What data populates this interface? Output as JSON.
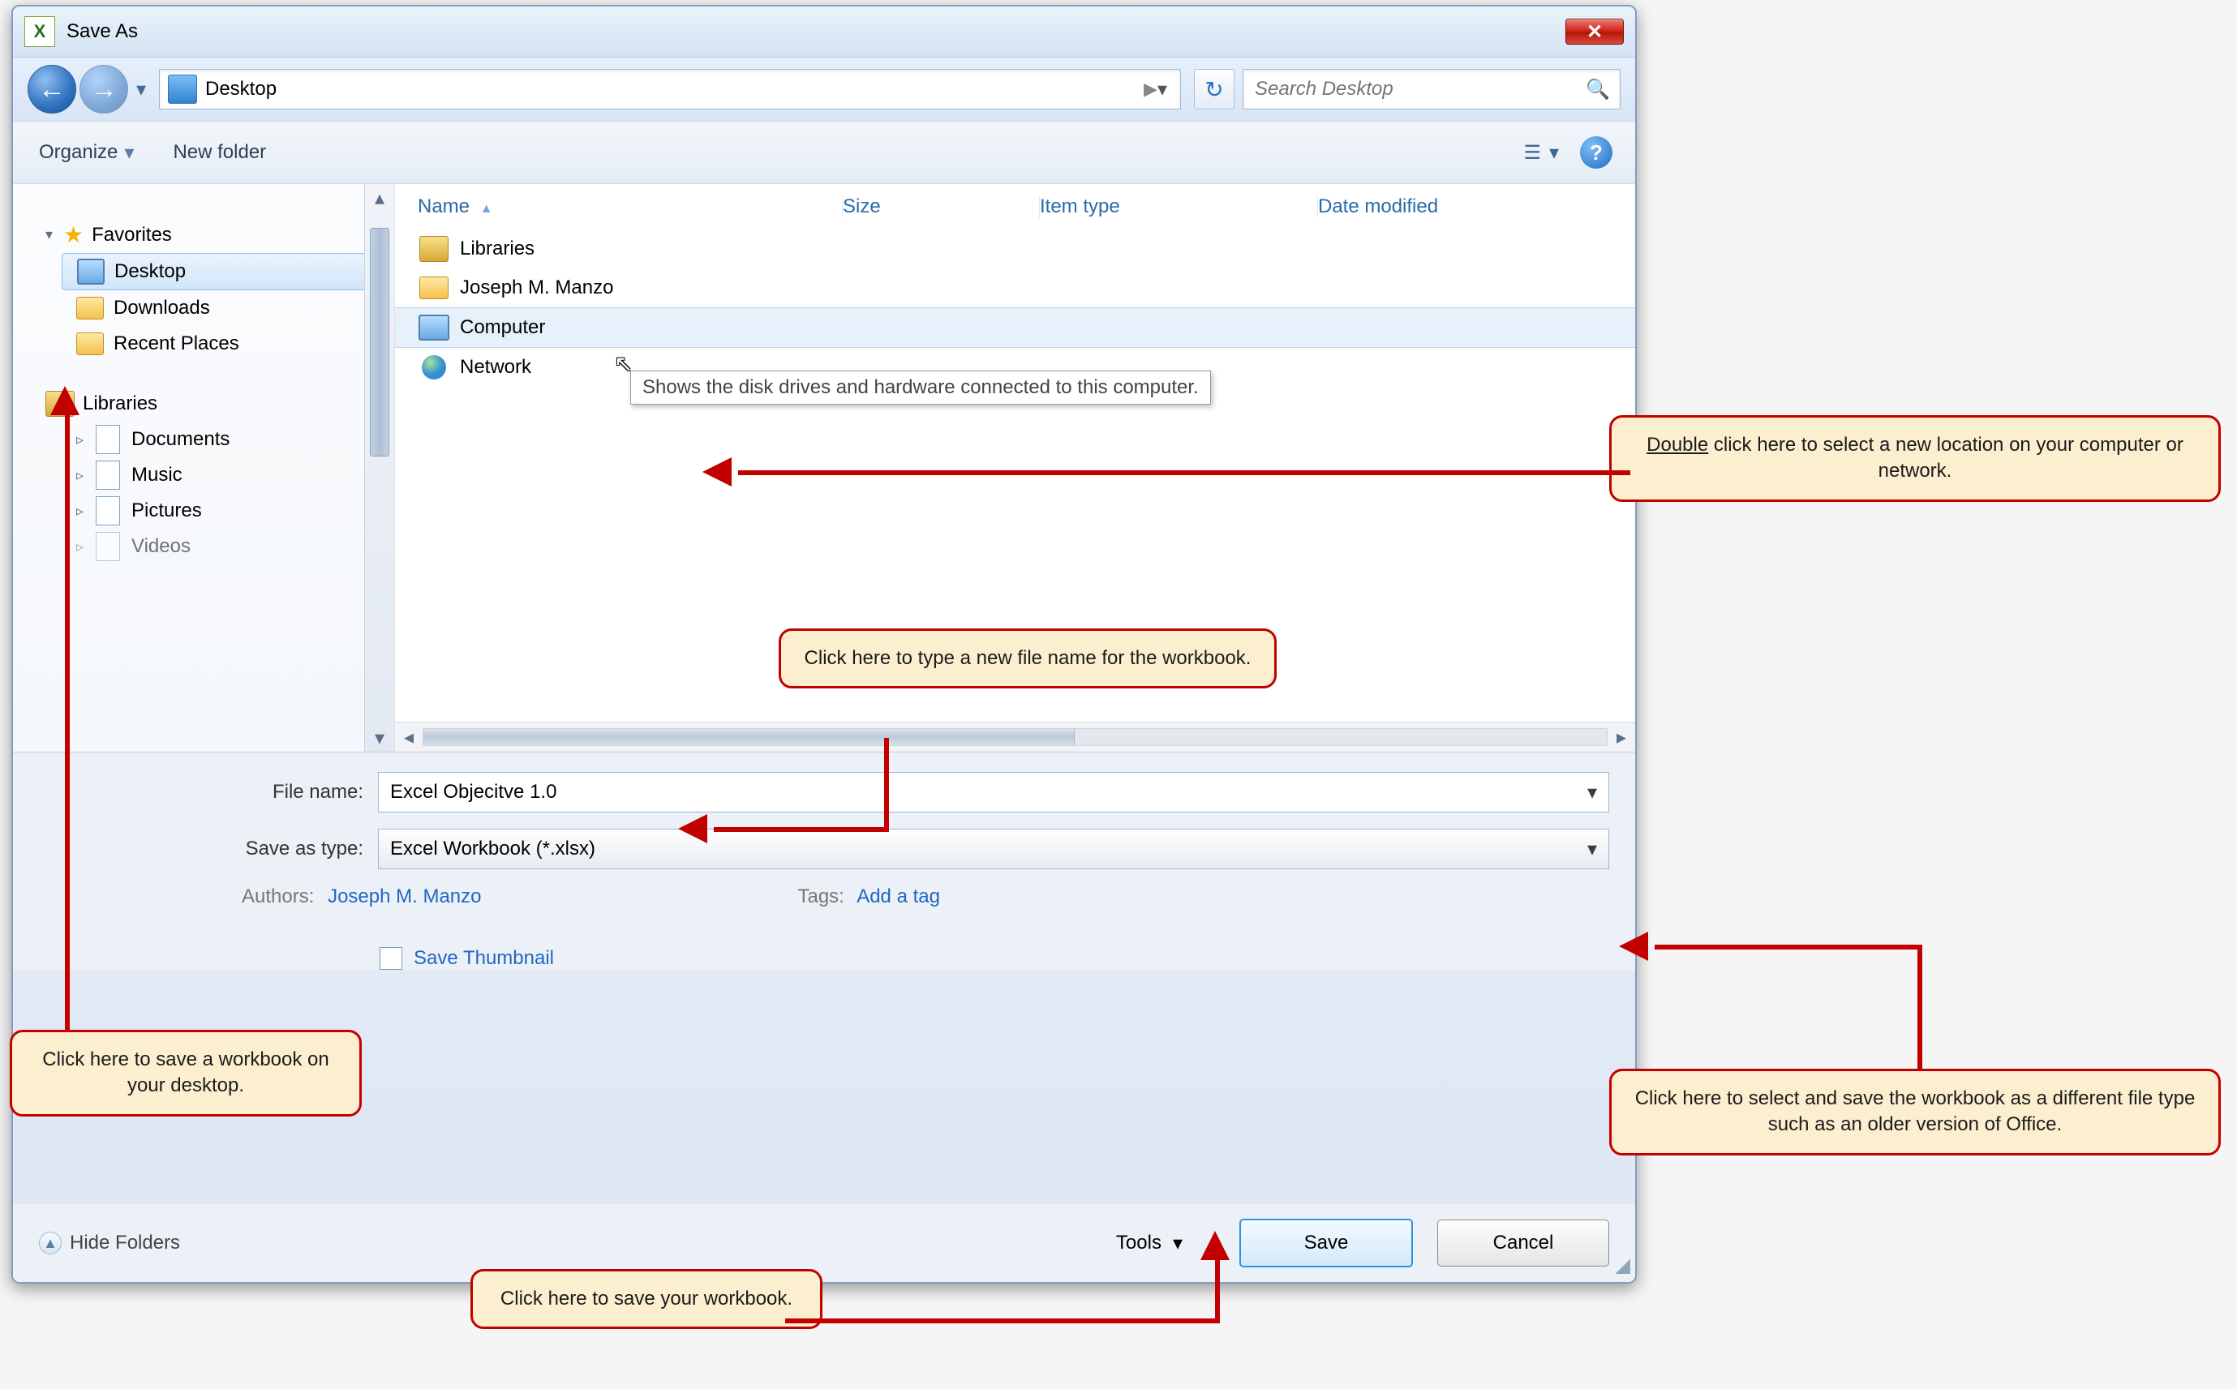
{
  "window": {
    "title": "Save As",
    "close_glyph": "✕"
  },
  "nav": {
    "address_icon": "▣",
    "address_text": "Desktop",
    "address_sep": "▶",
    "address_dropdown": "▾",
    "refresh_icon": "↻",
    "search_placeholder": "Search Desktop",
    "search_icon": "🔍",
    "back_arrow": "←",
    "forward_arrow": "→",
    "history_dropdown": "▾"
  },
  "toolbar": {
    "organize": "Organize",
    "organize_arrow": "▾",
    "new_folder": "New folder",
    "view_icon": "☰",
    "view_arrow": "▾",
    "help_glyph": "?"
  },
  "columns": {
    "name": "Name",
    "size": "Size",
    "type": "Item type",
    "date": "Date modified",
    "sort_asc": "▲"
  },
  "tree": {
    "favorites": {
      "label": "Favorites",
      "expander": "▾",
      "items": [
        {
          "icon": "monitor",
          "label": "Desktop",
          "selected": true
        },
        {
          "icon": "folder",
          "label": "Downloads"
        },
        {
          "icon": "folder",
          "label": "Recent Places"
        }
      ]
    },
    "libraries": {
      "label": "Libraries",
      "expander": "▾",
      "items": [
        {
          "icon": "doc",
          "label": "Documents",
          "expander": "▹"
        },
        {
          "icon": "music",
          "label": "Music",
          "expander": "▹"
        },
        {
          "icon": "picture",
          "label": "Pictures",
          "expander": "▹"
        },
        {
          "icon": "video",
          "label": "Videos",
          "expander": "▹"
        }
      ]
    }
  },
  "files": [
    {
      "icon": "lib",
      "name": "Libraries"
    },
    {
      "icon": "folder",
      "name": "Joseph M. Manzo"
    },
    {
      "icon": "monitor",
      "name": "Computer",
      "hover": true,
      "tooltip": "Shows the disk drives and hardware connected to this computer."
    },
    {
      "icon": "globe",
      "name": "Network"
    }
  ],
  "form": {
    "filename_label": "File name:",
    "filename_value": "Excel Objecitve 1.0",
    "savetype_label": "Save as type:",
    "savetype_value": "Excel Workbook (*.xlsx)",
    "authors_label": "Authors:",
    "authors_value": "Joseph M. Manzo",
    "tags_label": "Tags:",
    "tags_value": "Add a tag",
    "thumbnail_label": "Save Thumbnail"
  },
  "footer": {
    "hide_folders": "Hide Folders",
    "hide_icon": "▲",
    "tools_label": "Tools",
    "tools_arrow": "▾",
    "save": "Save",
    "cancel": "Cancel"
  },
  "callouts": {
    "double_click_prefix": "Double",
    "double_click_rest": " click here to select a new location on your computer or network.",
    "filename": "Click here to type a new file name for the workbook.",
    "desktop": "Click here to save a workbook on your desktop.",
    "save": "Click here to save your workbook.",
    "saveastype": "Click here to select and save the workbook as a different file type such as an older version of Office."
  }
}
